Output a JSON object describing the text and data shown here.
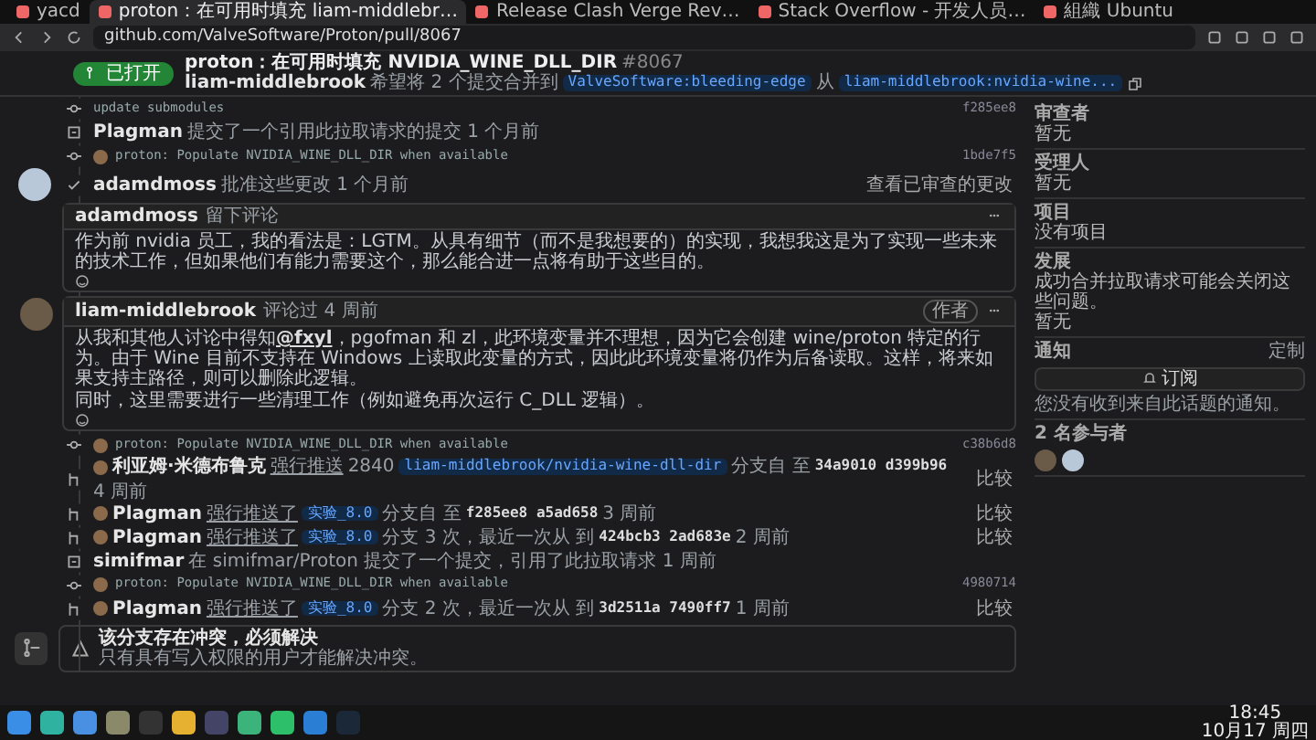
{
  "browser": {
    "tabs": [
      {
        "title": "yacd",
        "selected": false
      },
      {
        "title": "proton：在可用时填充 liam-middlebr…",
        "selected": true
      },
      {
        "title": "Release Clash Verge Rev…",
        "selected": false
      },
      {
        "title": "Stack Overflow - 开发人员…",
        "selected": false
      },
      {
        "title": "組織 Ubuntu",
        "selected": false
      }
    ],
    "address": "github.com/ValveSoftware/Proton/pull/8067"
  },
  "pr": {
    "state": "已打开",
    "title": "proton：在可用时填充 NVIDIA_WINE_DLL_DIR",
    "number": "#8067",
    "author": "liam-middlebrook",
    "summary": "希望将 2 个提交合并到",
    "base": "ValveSoftware:bleeding-edge",
    "from": "从",
    "head": "liam-middlebrook:nvidia-wine..."
  },
  "timeline": [
    {
      "kind": "commit",
      "avatar": false,
      "message": "update submodules",
      "sha": "f285ee8"
    },
    {
      "kind": "reference",
      "parts": [
        {
          "user": "Plagman"
        },
        {
          "text": "提交了一个引用此拉取请求的提交 1 个月前"
        }
      ]
    },
    {
      "kind": "commit",
      "avatar": true,
      "message": "proton: Populate NVIDIA_WINE_DLL_DIR when available",
      "sha": "1bde7f5"
    },
    {
      "kind": "approval",
      "parts": [
        {
          "user": "adamdmoss"
        },
        {
          "text": "批准这些更改 1 个月前"
        }
      ],
      "action": "查看已审查的更改"
    },
    {
      "kind": "comment",
      "author": "adamdmoss",
      "verb": "留下评论",
      "paragraphs": [
        [
          {
            "text": "作为前 nvidia 员工，我的看法是：LGTM。从具有细节（而不是我想要的）的实现，我想我这是为了实现一些未来的技术工作，但如果他们有能力需要这个，那么能合进一点将有助于这些目的。"
          }
        ]
      ]
    },
    {
      "kind": "comment",
      "author": "liam-middlebrook",
      "verb": "评论过 4 周前",
      "author_badge": "作者",
      "paragraphs": [
        [
          {
            "text": "从我和其他人讨论中得知"
          },
          {
            "mention": "@fxyl"
          },
          {
            "text": "，pgofman 和 zl，此环境变量并不理想，因为它会创建 wine/proton 特定的行为。由于 Wine 目前不支持在 Windows 上读取此变量的方式，因此此环境变量将仍作为后备读取。这样，将来如果支持主路径，则可以删除此逻辑。"
          }
        ],
        [
          {
            "text": "同时，这里需要进行一些清理工作（例如避免再次运行 C_DLL 逻辑）。"
          }
        ]
      ]
    },
    {
      "kind": "commit",
      "avatar": true,
      "message": "proton: Populate NVIDIA_WINE_DLL_DIR when available",
      "sha": "c38b6d8"
    },
    {
      "kind": "push",
      "parts": [
        {
          "user": "利亚姆·米德布鲁克"
        },
        {
          "link": "强行推送"
        },
        {
          "text": "2840"
        },
        {
          "branch": "liam-middlebrook/nvidia-wine-dll-dir"
        },
        {
          "text": "分支自 至"
        },
        {
          "sha": "34a9010 d399b96"
        },
        {
          "text": "4 周前"
        }
      ],
      "action": "比较"
    },
    {
      "kind": "push",
      "parts": [
        {
          "user": "Plagman"
        },
        {
          "link": "强行推送了"
        },
        {
          "branch": "实验_8.0"
        },
        {
          "text": "分支自 至"
        },
        {
          "sha": "f285ee8 a5ad658"
        },
        {
          "text": "3 周前"
        }
      ],
      "action": "比较"
    },
    {
      "kind": "push",
      "parts": [
        {
          "user": "Plagman"
        },
        {
          "link": "强行推送了"
        },
        {
          "branch": "实验_8.0"
        },
        {
          "text": "分支 3 次，最近一次从 到"
        },
        {
          "sha": "424bcb3 2ad683e"
        },
        {
          "text": "2 周前"
        }
      ],
      "action": "比较"
    },
    {
      "kind": "reference",
      "parts": [
        {
          "user": "simifmar"
        },
        {
          "text": "在 simifmar/Proton 提交了一个提交，引用了此拉取请求 1 周前"
        }
      ]
    },
    {
      "kind": "commit",
      "avatar": true,
      "message": "proton: Populate NVIDIA_WINE_DLL_DIR when available",
      "sha": "4980714"
    },
    {
      "kind": "push",
      "parts": [
        {
          "user": "Plagman"
        },
        {
          "link": "强行推送了"
        },
        {
          "branch": "实验_8.0"
        },
        {
          "text": "分支 2 次，最近一次从 到"
        },
        {
          "sha": "3d2511a 7490ff7"
        },
        {
          "text": "1 周前"
        }
      ],
      "action": "比较"
    }
  ],
  "merge": {
    "title": "该分支存在冲突，必须解决",
    "note": "只有具有写入权限的用户才能解决冲突。"
  },
  "sidebar": {
    "sections": [
      {
        "label": "审查者",
        "value": "暂无"
      },
      {
        "label": "受理人",
        "value": "暂无"
      },
      {
        "label": "项目",
        "value": "没有项目"
      },
      {
        "label": "发展",
        "value": "成功合并拉取请求可能会关闭这些问题。",
        "extra": "暂无"
      }
    ],
    "notifications": {
      "label": "通知",
      "action": "定制",
      "button": "订阅",
      "note": "您没有收到来自此话题的通知。"
    },
    "participants": {
      "label": "2 名参与者",
      "people": [
        {
          "kind": "photo"
        },
        {
          "kind": "default"
        }
      ]
    }
  },
  "taskbar": {
    "time": "18:45",
    "date": "10月17 周四"
  }
}
